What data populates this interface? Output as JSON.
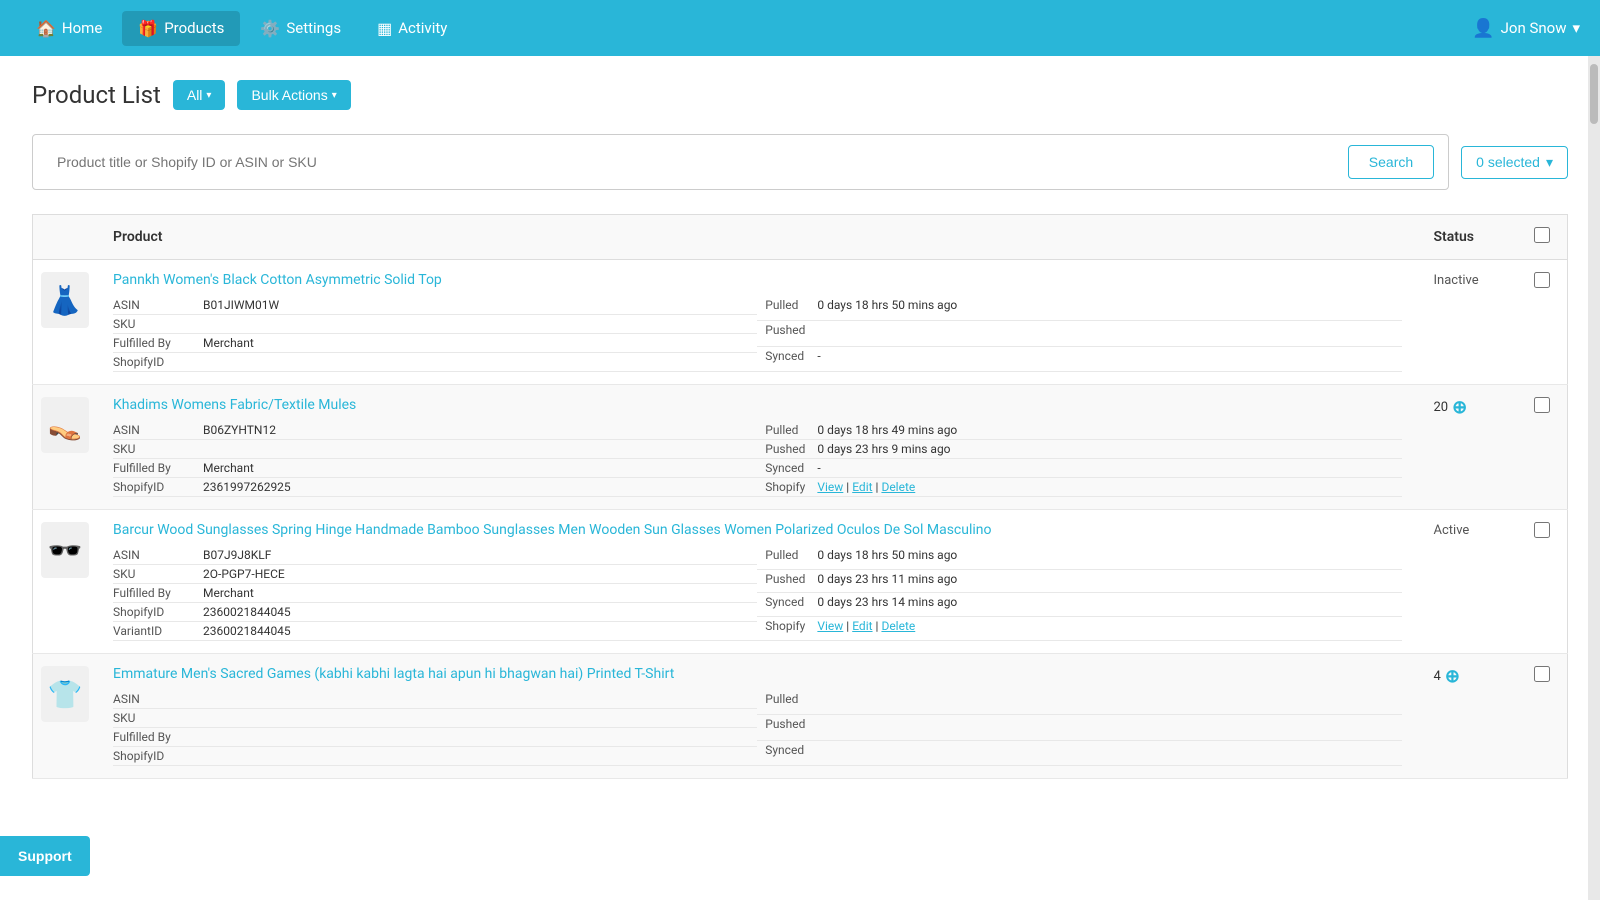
{
  "navbar": {
    "brand_icon": "🏠",
    "items": [
      {
        "id": "home",
        "label": "Home",
        "icon": "🏠",
        "active": false
      },
      {
        "id": "products",
        "label": "Products",
        "icon": "🎁",
        "active": true
      },
      {
        "id": "settings",
        "label": "Settings",
        "icon": "⚙️",
        "active": false
      },
      {
        "id": "activity",
        "label": "Activity",
        "icon": "▦",
        "active": false
      }
    ],
    "user": {
      "icon": "👤",
      "name": "Jon Snow",
      "caret": "▾"
    }
  },
  "page": {
    "title": "Product List",
    "all_button": "All",
    "bulk_actions_button": "Bulk Actions"
  },
  "search": {
    "placeholder": "Product title or Shopify ID or ASIN or SKU",
    "button_label": "Search",
    "selected_label": "0 selected"
  },
  "table": {
    "headers": {
      "product": "Product",
      "status": "Status"
    },
    "products": [
      {
        "id": 1,
        "image_emoji": "👗",
        "title": "Pannkh Women's Black Cotton Asymmetric Solid Top",
        "asin": "B01JIWM01W",
        "sku": "",
        "fulfilled_by": "Merchant",
        "shopify_id": "",
        "pulled": "0 days 18 hrs 50 mins ago",
        "pushed": "",
        "synced": "-",
        "shopify_links": null,
        "status": "Inactive",
        "status_type": "inactive",
        "count": null
      },
      {
        "id": 2,
        "image_emoji": "👡",
        "title": "Khadims Womens Fabric/Textile Mules",
        "asin": "B06ZYHTN12",
        "sku": "",
        "fulfilled_by": "Merchant",
        "shopify_id": "2361997262925",
        "pulled": "0 days 18 hrs 49 mins ago",
        "pushed": "0 days 23 hrs 9 mins ago",
        "synced": "-",
        "shopify_links": {
          "view": "View",
          "edit": "Edit",
          "delete": "Delete"
        },
        "status": null,
        "status_type": "count",
        "count": "20"
      },
      {
        "id": 3,
        "image_emoji": "🕶️",
        "title": "Barcur Wood Sunglasses Spring Hinge Handmade Bamboo Sunglasses Men Wooden Sun Glasses Women Polarized Oculos De Sol Masculino",
        "asin": "B07J9J8KLF",
        "sku": "2O-PGP7-HECE",
        "fulfilled_by": "Merchant",
        "shopify_id": "2360021844045",
        "variant_id": "2360021844045",
        "pulled": "0 days 18 hrs 50 mins ago",
        "pushed": "0 days 23 hrs 11 mins ago",
        "synced": "0 days 23 hrs 14 mins ago",
        "shopify_links": {
          "view": "View",
          "edit": "Edit",
          "delete": "Delete"
        },
        "status": "Active",
        "status_type": "active",
        "count": null
      },
      {
        "id": 4,
        "image_emoji": "👕",
        "title": "Emmature Men's Sacred Games (kabhi kabhi lagta hai apun hi bhagwan hai) Printed T-Shirt",
        "asin": "",
        "sku": "",
        "fulfilled_by": "",
        "shopify_id": "",
        "pulled": "",
        "pushed": "",
        "synced": "",
        "shopify_links": null,
        "status": null,
        "status_type": "count",
        "count": "4"
      }
    ]
  },
  "support_label": "Support"
}
